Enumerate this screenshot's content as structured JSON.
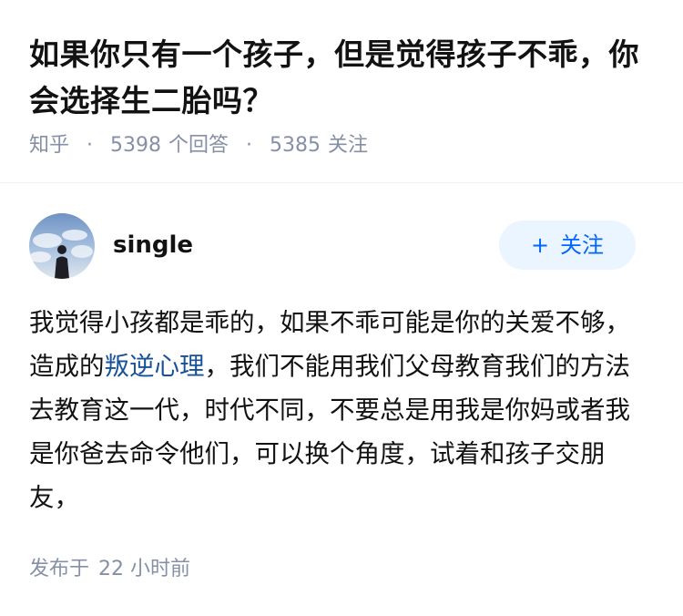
{
  "question": {
    "title": "如果你只有一个孩子，但是觉得孩子不乖，你会选择生二胎吗？",
    "source": "知乎",
    "answer_count": "5398",
    "answer_count_label": "个回答",
    "follower_count": "5385",
    "follower_count_label": "关注",
    "separator": "·"
  },
  "answer": {
    "author": {
      "name": "single",
      "avatar_icon": "avatar-sky-photo"
    },
    "follow_button": {
      "plus": "+",
      "label": "关注"
    },
    "content": {
      "before_link": "我觉得小孩都是乖的，如果不乖可能是你的关爱不够，造成的",
      "link_text": "叛逆心理",
      "after_link": "，我们不能用我们父母教育我们的方法去教育这一代，时代不同，不要总是用我是你妈或者我是你爸去命令他们，可以换个角度，试着和孩子交朋友，"
    },
    "published_prefix": "发布于",
    "published_time": "22 小时前"
  },
  "colors": {
    "text": "#121212",
    "meta": "#8590a6",
    "link": "#175199",
    "accent": "#0066ff",
    "button_bg": "#ebf5ff"
  }
}
